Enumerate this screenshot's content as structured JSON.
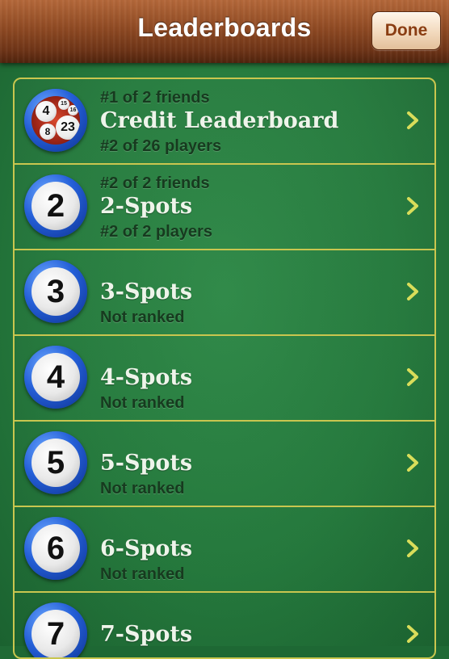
{
  "navbar": {
    "title": "Leaderboards",
    "done_label": "Done"
  },
  "rows": [
    {
      "badge": "multi",
      "friends": "#1 of 2 friends",
      "title": "Credit Leaderboard",
      "rank": "#2 of 26 players",
      "balls": [
        "4",
        "23",
        "8",
        "15",
        "16"
      ]
    },
    {
      "badge": "2",
      "friends": "#2 of 2 friends",
      "title": "2-Spots",
      "rank": "#2 of 2 players"
    },
    {
      "badge": "3",
      "title": "3-Spots",
      "rank": "Not ranked"
    },
    {
      "badge": "4",
      "title": "4-Spots",
      "rank": "Not ranked"
    },
    {
      "badge": "5",
      "title": "5-Spots",
      "rank": "Not ranked"
    },
    {
      "badge": "6",
      "title": "6-Spots",
      "rank": "Not ranked"
    },
    {
      "badge": "7",
      "title": "7-Spots"
    }
  ],
  "icons": {
    "chevron": "chevron-right-icon"
  },
  "colors": {
    "felt": "#257a3d",
    "border": "#c9c64f",
    "chevron": "#d9dd5a",
    "badge_ring": "#2560d8"
  }
}
